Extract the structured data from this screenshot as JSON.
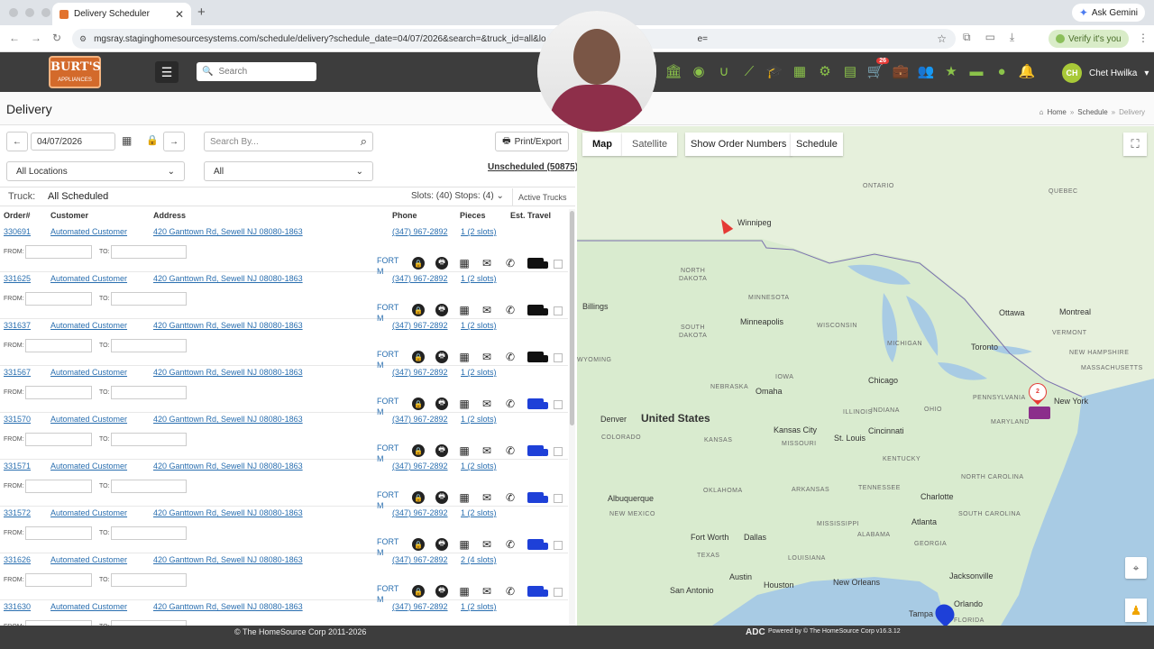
{
  "browser": {
    "tab_title": "Delivery Scheduler",
    "url": "mgsray.staginghomesourcesystems.com/schedule/delivery?schedule_date=04/07/2026&search=&truck_id=all&lo",
    "url_tail": "e=",
    "ask_gemini": "Ask Gemini",
    "verify": "Verify it's you"
  },
  "header": {
    "logo_text": "BURT'S",
    "logo_sub": "APPLIANCES",
    "search_placeholder": "Search",
    "cart_count": "26",
    "user_initials": "CH",
    "user_name": "Chet Hwilka"
  },
  "page": {
    "title": "Delivery",
    "breadcrumbs": [
      "Home",
      "Schedule",
      "Delivery"
    ]
  },
  "controls": {
    "date": "04/07/2026",
    "search_placeholder": "Search By...",
    "print_label": "Print/Export",
    "location_select": "All Locations",
    "all_select": "All",
    "unscheduled": "Unscheduled (50875)"
  },
  "truck_bar": {
    "label": "Truck:",
    "value": "All Scheduled",
    "slots": "Slots: (40) Stops: (4)",
    "active_trucks": "Active Trucks"
  },
  "table": {
    "headers": {
      "order": "Order#",
      "customer": "Customer",
      "address": "Address",
      "phone": "Phone",
      "pieces": "Pieces",
      "travel": "Est. Travel"
    },
    "from_label": "FROM:",
    "to_label": "TO:",
    "rows": [
      {
        "order": "330691",
        "customer": "Automated Customer",
        "address": "420 Ganttown Rd, Sewell NJ 08080-1863",
        "phone": "(347) 967-2892",
        "pieces": "1 (2 slots)",
        "fort1": "FORT",
        "fort2": "M",
        "truck_color": "#111111"
      },
      {
        "order": "331625",
        "customer": "Automated Customer",
        "address": "420 Ganttown Rd, Sewell NJ 08080-1863",
        "phone": "(347) 967-2892",
        "pieces": "1 (2 slots)",
        "fort1": "FORT",
        "fort2": "M",
        "truck_color": "#111111"
      },
      {
        "order": "331637",
        "customer": "Automated Customer",
        "address": "420 Ganttown Rd, Sewell NJ 08080-1863",
        "phone": "(347) 967-2892",
        "pieces": "1 (2 slots)",
        "fort1": "FORT",
        "fort2": "M",
        "truck_color": "#111111"
      },
      {
        "order": "331567",
        "customer": "Automated Customer",
        "address": "420 Ganttown Rd, Sewell NJ 08080-1863",
        "phone": "(347) 967-2892",
        "pieces": "1 (2 slots)",
        "fort1": "FORT",
        "fort2": "M",
        "truck_color": "#1e40d8"
      },
      {
        "order": "331570",
        "customer": "Automated Customer",
        "address": "420 Ganttown Rd, Sewell NJ 08080-1863",
        "phone": "(347) 967-2892",
        "pieces": "1 (2 slots)",
        "fort1": "FORT",
        "fort2": "M",
        "truck_color": "#1e40d8"
      },
      {
        "order": "331571",
        "customer": "Automated Customer",
        "address": "420 Ganttown Rd, Sewell NJ 08080-1863",
        "phone": "(347) 967-2892",
        "pieces": "1 (2 slots)",
        "fort1": "FORT",
        "fort2": "M",
        "truck_color": "#1e40d8"
      },
      {
        "order": "331572",
        "customer": "Automated Customer",
        "address": "420 Ganttown Rd, Sewell NJ 08080-1863",
        "phone": "(347) 967-2892",
        "pieces": "1 (2 slots)",
        "fort1": "FORT",
        "fort2": "M",
        "truck_color": "#1e40d8"
      },
      {
        "order": "331626",
        "customer": "Automated Customer",
        "address": "420 Ganttown Rd, Sewell NJ 08080-1863",
        "phone": "(347) 967-2892",
        "pieces": "2 (4 slots)",
        "fort1": "FORT",
        "fort2": "M",
        "truck_color": "#1e40d8"
      },
      {
        "order": "331630",
        "customer": "Automated Customer",
        "address": "420 Ganttown Rd, Sewell NJ 08080-1863",
        "phone": "(347) 967-2892",
        "pieces": "1 (2 slots)",
        "fort1": "FORT",
        "fort2": "M",
        "truck_color": "#1e40d8"
      }
    ]
  },
  "map": {
    "tab_map": "Map",
    "tab_satellite": "Satellite",
    "show_order_numbers": "Show Order Numbers",
    "schedule": "Schedule",
    "marker_label": "2",
    "labels": {
      "ontario": "ONTARIO",
      "quebec": "QUEBEC",
      "winnipeg": "Winnipeg",
      "north_dakota_1": "NORTH",
      "north_dakota_2": "DAKOTA",
      "south_dakota_1": "SOUTH",
      "south_dakota_2": "DAKOTA",
      "minnesota": "MINNESOTA",
      "minneapolis": "Minneapolis",
      "wisconsin": "WISCONSIN",
      "michigan": "MICHIGAN",
      "ottawa": "Ottawa",
      "montreal": "Montreal",
      "toronto": "Toronto",
      "iowa": "IOWA",
      "chicago": "Chicago",
      "nebraska": "NEBRASKA",
      "omaha": "Omaha",
      "wyoming": "WYOMING",
      "billings": "Billings",
      "denver": "Denver",
      "united_states": "United States",
      "colorado": "COLORADO",
      "kansas": "KANSAS",
      "kansas_city": "Kansas City",
      "missouri": "MISSOURI",
      "st_louis": "St. Louis",
      "illinois": "ILLINOIS",
      "indiana": "INDIANA",
      "ohio": "OHIO",
      "cincinnati": "Cincinnati",
      "kentucky": "KENTUCKY",
      "pennsylvania": "PENNSYLVANIA",
      "new_york": "New York",
      "maryland": "MARYLAND",
      "vermont": "VERMONT",
      "new_hampshire": "NEW HAMPSHIRE",
      "massachusetts": "MASSACHUSETTS",
      "tennessee": "TENNESSEE",
      "charlotte": "Charlotte",
      "atlanta": "Atlanta",
      "north_carolina": "NORTH CAROLINA",
      "south_carolina": "SOUTH CAROLINA",
      "mississippi": "MISSISSIPPI",
      "alabama": "ALABAMA",
      "georgia": "GEORGIA",
      "arkansas": "ARKANSAS",
      "oklahoma": "OKLAHOMA",
      "new_mexico": "NEW MEXICO",
      "albuquerque": "Albuquerque",
      "texas": "TEXAS",
      "fort_worth": "Fort Worth",
      "dallas": "Dallas",
      "austin": "Austin",
      "houston": "Houston",
      "san_antonio": "San Antonio",
      "new_orleans": "New Orleans",
      "louisiana": "LOUISIANA",
      "jacksonville": "Jacksonville",
      "tampa": "Tampa",
      "orlando": "Orlando",
      "florida": "FLORIDA"
    }
  },
  "footer": {
    "copyright": "© The HomeSource Corp 2011-2026",
    "adc": "ADC",
    "powered": "Powered by © The HomeSource Corp  v16.3.12"
  }
}
